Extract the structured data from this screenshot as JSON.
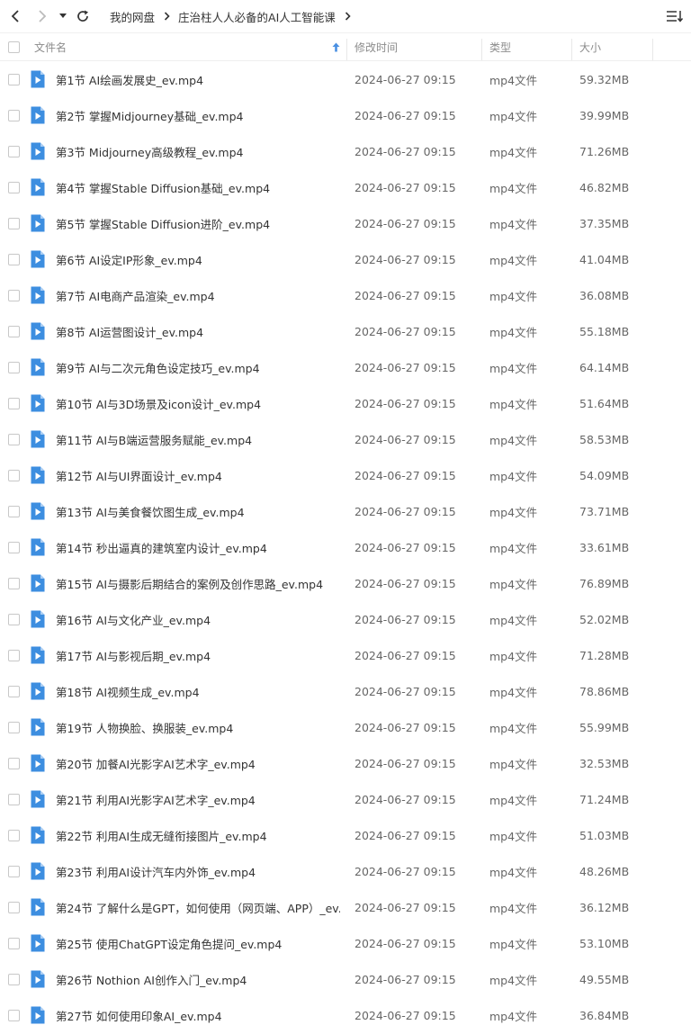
{
  "toolbar": {
    "icons": [
      "back-icon",
      "forward-icon",
      "dropdown-icon",
      "refresh-icon",
      "list-view-icon"
    ],
    "breadcrumb": [
      "我的网盘",
      "庄治柱人人必备的AI人工智能课"
    ]
  },
  "columns": {
    "name": "文件名",
    "time": "修改时间",
    "type": "类型",
    "size": "大小"
  },
  "colors": {
    "file_icon": "#3d8ee0",
    "header_text": "#8c8c8c",
    "sort_arrow": "#4a90e2"
  },
  "files": [
    {
      "name": "第1节 AI绘画发展史_ev.mp4",
      "time": "2024-06-27 09:15",
      "type": "mp4文件",
      "size": "59.32MB"
    },
    {
      "name": "第2节 掌握Midjourney基础_ev.mp4",
      "time": "2024-06-27 09:15",
      "type": "mp4文件",
      "size": "39.99MB"
    },
    {
      "name": "第3节 Midjourney高级教程_ev.mp4",
      "time": "2024-06-27 09:15",
      "type": "mp4文件",
      "size": "71.26MB"
    },
    {
      "name": "第4节 掌握Stable Diffusion基础_ev.mp4",
      "time": "2024-06-27 09:15",
      "type": "mp4文件",
      "size": "46.82MB"
    },
    {
      "name": "第5节 掌握Stable Diffusion进阶_ev.mp4",
      "time": "2024-06-27 09:15",
      "type": "mp4文件",
      "size": "37.35MB"
    },
    {
      "name": "第6节 AI设定IP形象_ev.mp4",
      "time": "2024-06-27 09:15",
      "type": "mp4文件",
      "size": "41.04MB"
    },
    {
      "name": "第7节 AI电商产品渲染_ev.mp4",
      "time": "2024-06-27 09:15",
      "type": "mp4文件",
      "size": "36.08MB"
    },
    {
      "name": "第8节 AI运营图设计_ev.mp4",
      "time": "2024-06-27 09:15",
      "type": "mp4文件",
      "size": "55.18MB"
    },
    {
      "name": "第9节 AI与二次元角色设定技巧_ev.mp4",
      "time": "2024-06-27 09:15",
      "type": "mp4文件",
      "size": "64.14MB"
    },
    {
      "name": "第10节 AI与3D场景及icon设计_ev.mp4",
      "time": "2024-06-27 09:15",
      "type": "mp4文件",
      "size": "51.64MB"
    },
    {
      "name": "第11节 AI与B端运营服务赋能_ev.mp4",
      "time": "2024-06-27 09:15",
      "type": "mp4文件",
      "size": "58.53MB"
    },
    {
      "name": "第12节 AI与UI界面设计_ev.mp4",
      "time": "2024-06-27 09:15",
      "type": "mp4文件",
      "size": "54.09MB"
    },
    {
      "name": "第13节 AI与美食餐饮图生成_ev.mp4",
      "time": "2024-06-27 09:15",
      "type": "mp4文件",
      "size": "73.71MB"
    },
    {
      "name": "第14节 秒出逼真的建筑室内设计_ev.mp4",
      "time": "2024-06-27 09:15",
      "type": "mp4文件",
      "size": "33.61MB"
    },
    {
      "name": "第15节 AI与摄影后期结合的案例及创作思路_ev.mp4",
      "time": "2024-06-27 09:15",
      "type": "mp4文件",
      "size": "76.89MB"
    },
    {
      "name": "第16节 AI与文化产业_ev.mp4",
      "time": "2024-06-27 09:15",
      "type": "mp4文件",
      "size": "52.02MB"
    },
    {
      "name": "第17节 AI与影视后期_ev.mp4",
      "time": "2024-06-27 09:15",
      "type": "mp4文件",
      "size": "71.28MB"
    },
    {
      "name": "第18节 AI视频生成_ev.mp4",
      "time": "2024-06-27 09:15",
      "type": "mp4文件",
      "size": "78.86MB"
    },
    {
      "name": "第19节 人物换脸、换服装_ev.mp4",
      "time": "2024-06-27 09:15",
      "type": "mp4文件",
      "size": "55.99MB"
    },
    {
      "name": "第20节 加餐AI光影字AI艺术字_ev.mp4",
      "time": "2024-06-27 09:15",
      "type": "mp4文件",
      "size": "32.53MB"
    },
    {
      "name": "第21节 利用AI光影字AI艺术字_ev.mp4",
      "time": "2024-06-27 09:15",
      "type": "mp4文件",
      "size": "71.24MB"
    },
    {
      "name": "第22节 利用AI生成无缝衔接图片_ev.mp4",
      "time": "2024-06-27 09:15",
      "type": "mp4文件",
      "size": "51.03MB"
    },
    {
      "name": "第23节 利用AI设计汽车内外饰_ev.mp4",
      "time": "2024-06-27 09:15",
      "type": "mp4文件",
      "size": "48.26MB"
    },
    {
      "name": "第24节 了解什么是GPT，如何使用（网页端、APP）_ev....",
      "time": "2024-06-27 09:15",
      "type": "mp4文件",
      "size": "36.12MB"
    },
    {
      "name": "第25节 使用ChatGPT设定角色提问_ev.mp4",
      "time": "2024-06-27 09:15",
      "type": "mp4文件",
      "size": "53.10MB"
    },
    {
      "name": "第26节 Nothion AI创作入门_ev.mp4",
      "time": "2024-06-27 09:15",
      "type": "mp4文件",
      "size": "49.55MB"
    },
    {
      "name": "第27节 如何使用印象AI_ev.mp4",
      "time": "2024-06-27 09:15",
      "type": "mp4文件",
      "size": "36.84MB"
    }
  ]
}
